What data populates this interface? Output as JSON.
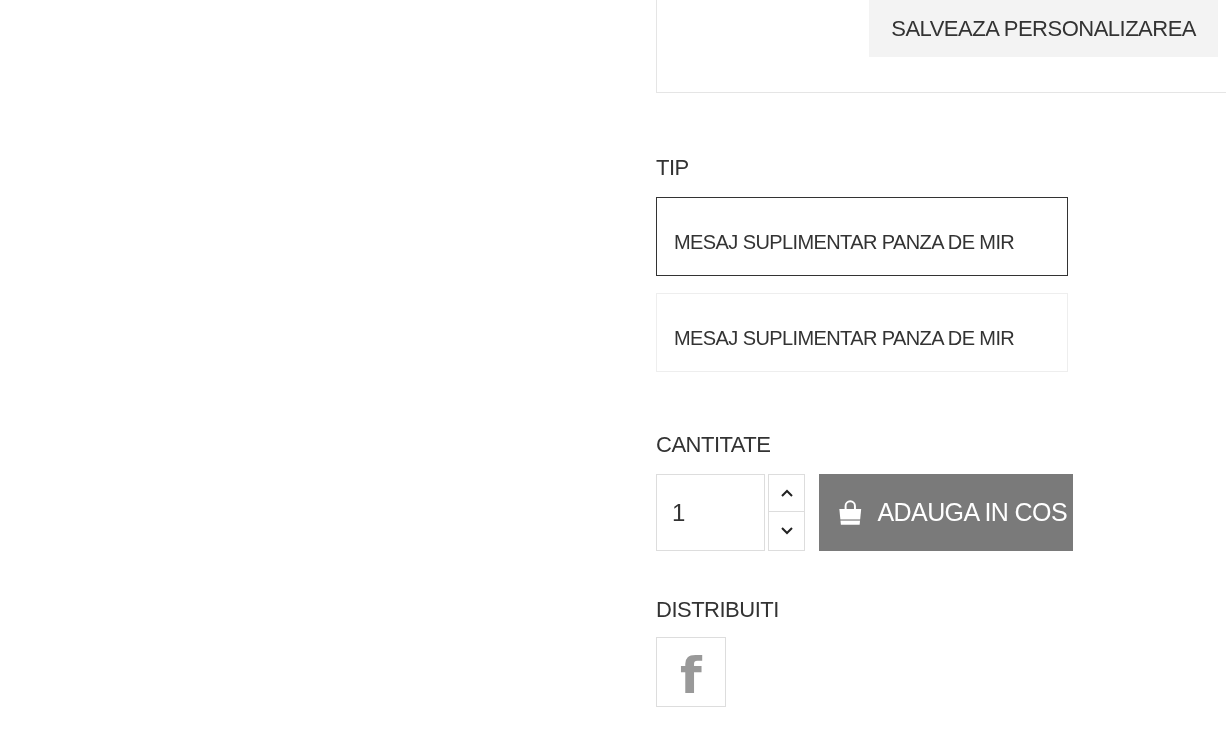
{
  "customization": {
    "save_button": "SALVEAZA PERSONALIZAREA"
  },
  "variant": {
    "label": "TIP",
    "options": [
      {
        "label": "MESAJ SUPLIMENTAR PANZA DE MIR",
        "selected": true
      },
      {
        "label": "MESAJ SUPLIMENTAR PANZA DE MIR",
        "selected": false
      }
    ]
  },
  "quantity": {
    "label": "CANTITATE",
    "value": "1"
  },
  "add_to_cart": "ADAUGA IN COS",
  "share": {
    "label": "DISTRIBUITI",
    "networks": [
      {
        "kind": "facebook",
        "glyph": "f"
      }
    ]
  }
}
